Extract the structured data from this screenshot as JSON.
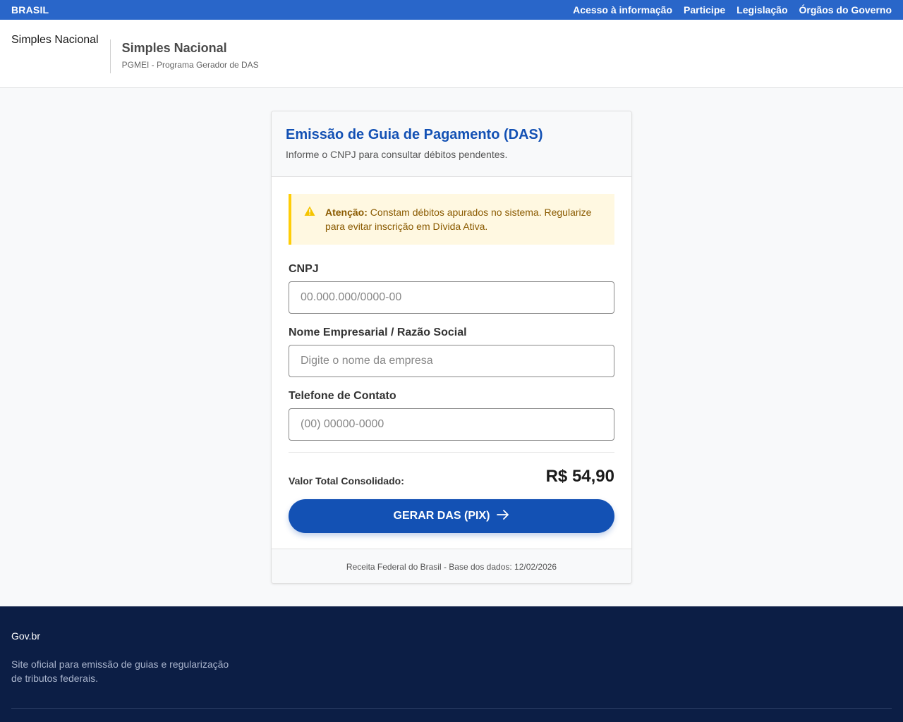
{
  "topbar": {
    "brand": "BRASIL",
    "links": [
      "Acesso à informação",
      "Participe",
      "Legislação",
      "Órgãos do Governo"
    ]
  },
  "header": {
    "logo": "Simples Nacional",
    "system_title": "Simples Nacional",
    "system_subtitle": "PGMEI - Programa Gerador de DAS"
  },
  "card": {
    "title": "Emissão de Guia de Pagamento (DAS)",
    "subtitle": "Informe o CNPJ para consultar débitos pendentes.",
    "alert": {
      "icon": "warning-triangle-icon",
      "strong": "Atenção:",
      "text": " Constam débitos apurados no sistema. Regularize para evitar inscrição em Dívida Ativa."
    },
    "fields": {
      "cnpj": {
        "label": "CNPJ",
        "placeholder": "00.000.000/0000-00",
        "value": ""
      },
      "nome": {
        "label": "Nome Empresarial / Razão Social",
        "placeholder": "Digite o nome da empresa",
        "value": ""
      },
      "telefone": {
        "label": "Telefone de Contato",
        "placeholder": "(00) 00000-0000",
        "value": ""
      }
    },
    "total_label": "Valor Total Consolidado:",
    "total_value": "R$ 54,90",
    "button_label": "GERAR DAS (PIX)",
    "footer": "Receita Federal do Brasil - Base dos dados: 12/02/2026"
  },
  "footer": {
    "name": "Gov.br",
    "description": "Site oficial para emissão de guias e regularização de tributos federais."
  },
  "colors": {
    "topbar": "#2966c9",
    "primary": "#1351b4",
    "alert_bg": "#fff8e1",
    "alert_border": "#ffcd07",
    "footer_bg": "#0c1e45"
  }
}
